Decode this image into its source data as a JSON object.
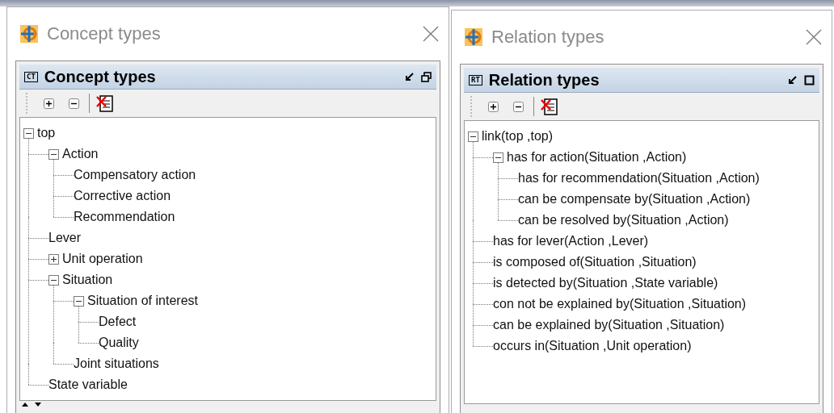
{
  "windows": [
    {
      "title": "Concept types",
      "panel": {
        "badge": "CT",
        "title": "Concept types",
        "dock_button": {
          "kind": "restore"
        },
        "tree": [
          {
            "label": "top",
            "expanded": true,
            "children": [
              {
                "label": "Action",
                "expanded": true,
                "children": [
                  {
                    "label": "Compensatory action"
                  },
                  {
                    "label": "Corrective action"
                  },
                  {
                    "label": "Recommendation"
                  }
                ]
              },
              {
                "label": "Lever"
              },
              {
                "label": "Unit operation",
                "expanded": false
              },
              {
                "label": "Situation",
                "expanded": true,
                "children": [
                  {
                    "label": "Situation of interest",
                    "expanded": true,
                    "children": [
                      {
                        "label": "Defect"
                      },
                      {
                        "label": "Quality"
                      }
                    ]
                  },
                  {
                    "label": "Joint situations"
                  }
                ]
              },
              {
                "label": "State variable"
              }
            ]
          }
        ]
      },
      "splitter": true
    },
    {
      "title": "Relation types",
      "panel": {
        "badge": "RT",
        "title": "Relation types",
        "dock_button": {
          "kind": "maximize"
        },
        "tree": [
          {
            "label": "link(top ,top)",
            "expanded": true,
            "children": [
              {
                "label": "has for action(Situation ,Action)",
                "expanded": true,
                "children": [
                  {
                    "label": "has for recommendation(Situation ,Action)"
                  },
                  {
                    "label": "can be compensate by(Situation ,Action)"
                  },
                  {
                    "label": "can be resolved by(Situation ,Action)"
                  }
                ]
              },
              {
                "label": "has for lever(Action ,Lever)"
              },
              {
                "label": "is composed of(Situation ,Situation)"
              },
              {
                "label": "is detected by(Situation ,State variable)"
              },
              {
                "label": "con not be explained by(Situation ,Situation)"
              },
              {
                "label": "can be explained by(Situation ,Situation)"
              },
              {
                "label": "occurs in(Situation ,Unit operation)"
              }
            ]
          }
        ]
      },
      "splitter": false
    }
  ]
}
